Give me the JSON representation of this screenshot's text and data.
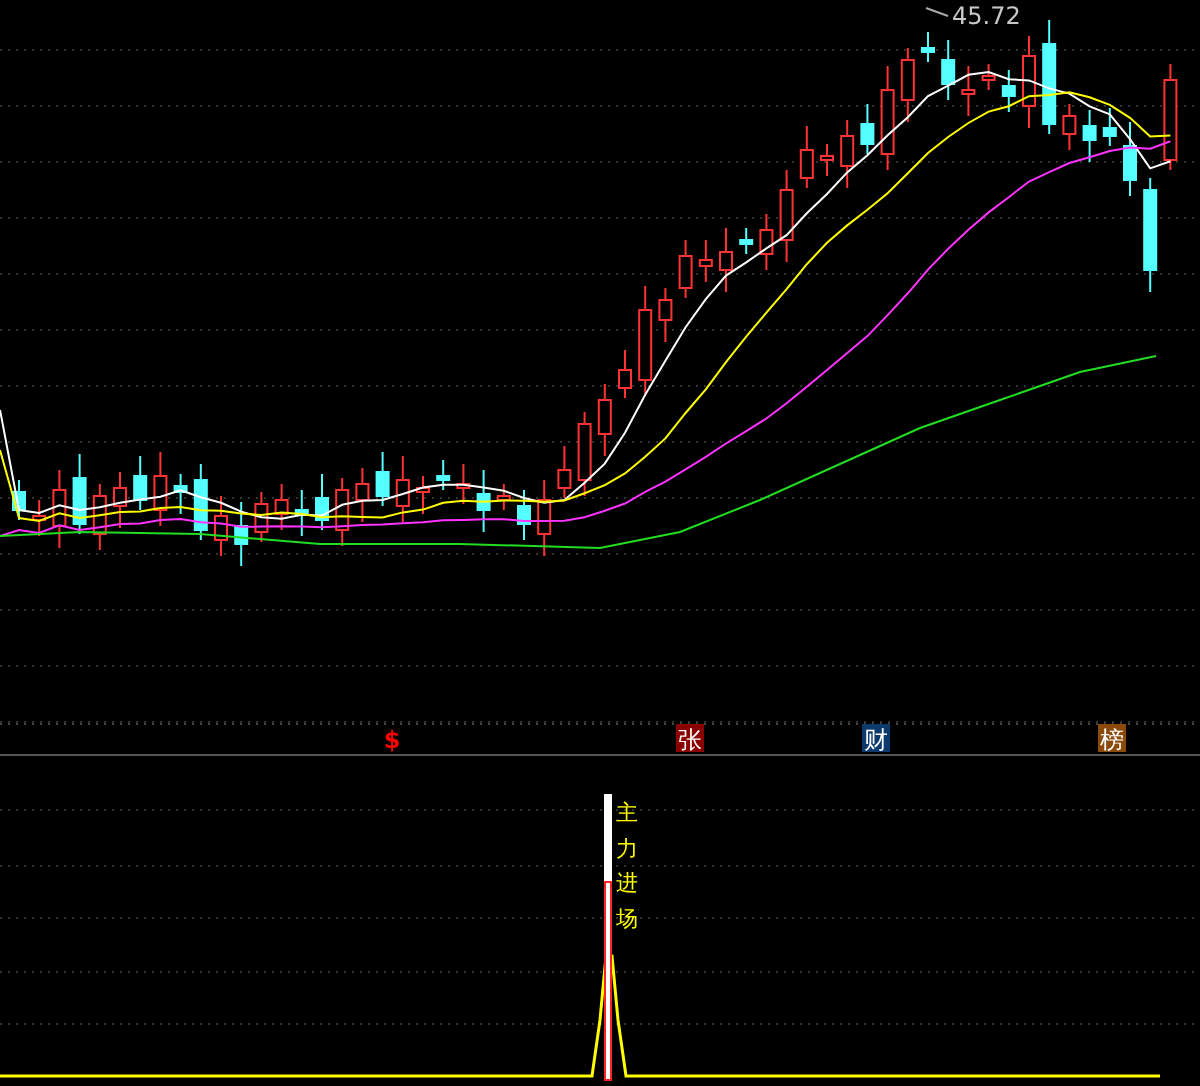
{
  "price_label": "45.72",
  "markers": [
    {
      "kind": "glyph",
      "text": "$",
      "color": "#ff0000"
    },
    {
      "kind": "tag",
      "text": "张",
      "color": "#8b0000"
    },
    {
      "kind": "tag",
      "text": "财",
      "color": "#0d3a6e"
    },
    {
      "kind": "tag",
      "text": "榜",
      "color": "#8b4a0a"
    }
  ],
  "signal_text": "主力进场"
}
